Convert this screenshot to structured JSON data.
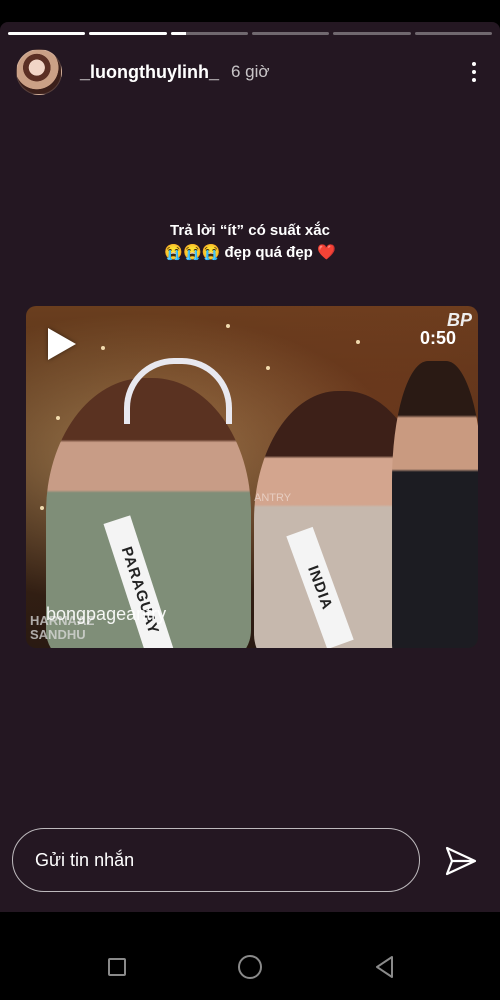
{
  "progress": [
    1,
    1,
    0.2,
    0,
    0,
    0
  ],
  "header": {
    "username": "_luongthuylinh_",
    "time": "6 giờ",
    "avatar_icon": "profile-photo",
    "more_icon": "vertical-ellipsis-icon"
  },
  "caption": {
    "line1": "Trả lời “ít” có suất xắc",
    "emojis": "😭😭😭",
    "line2_text": "đẹp quá đẹp",
    "heart": "❤️"
  },
  "video": {
    "duration": "0:50",
    "channel_badge": "BP",
    "watermark": "bongpageantry",
    "name_overlay_1": "HARNAAZ",
    "name_overlay_2": "SANDHU",
    "faint_text": "ANTRY",
    "sash_left": "PARAGUAY",
    "sash_right": "INDIA",
    "play_icon": "play-icon"
  },
  "reply": {
    "placeholder": "Gửi tin nhắn",
    "send_icon": "send-icon"
  },
  "navbar": {
    "recent_icon": "recent-apps-icon",
    "home_icon": "home-icon",
    "back_icon": "back-icon"
  },
  "colors": {
    "story_bg": "#241722",
    "page_bg": "#000000",
    "text": "#ffffff"
  }
}
